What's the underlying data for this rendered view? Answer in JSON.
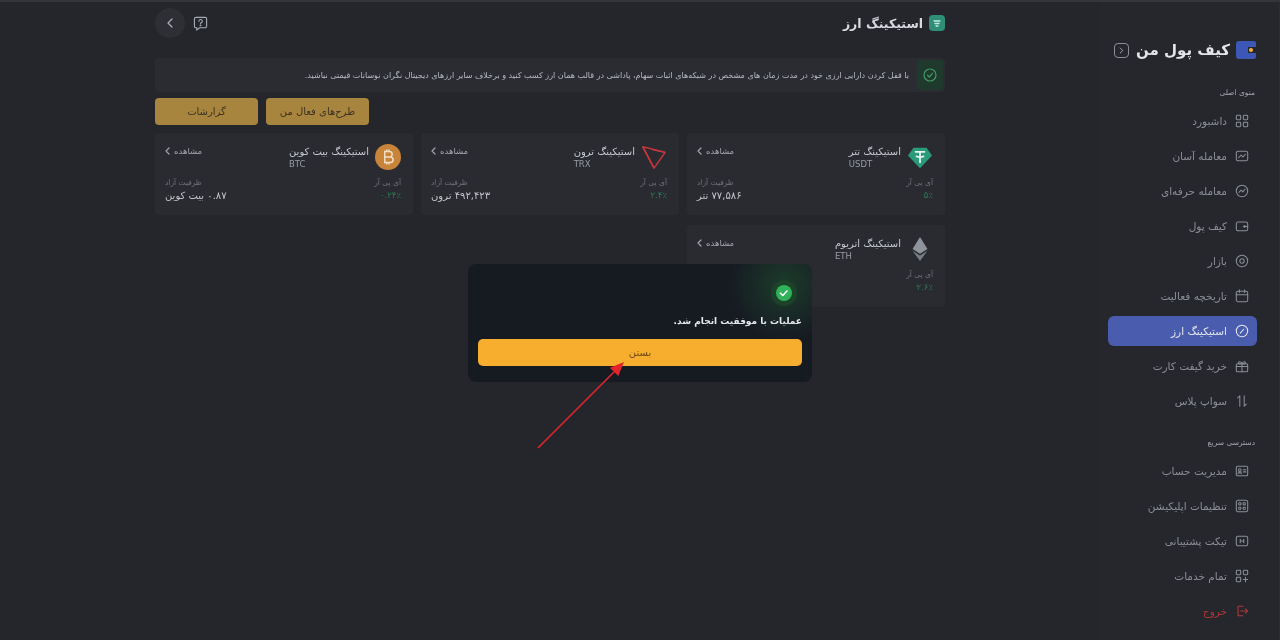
{
  "sidebar": {
    "logo": "کیف پول من",
    "sections": [
      {
        "title": "منوی اصلی",
        "items": [
          {
            "label": "داشبورد",
            "kind": "dashboard",
            "selected": false
          },
          {
            "label": "معامله آسان",
            "kind": "easy-trade",
            "selected": false
          },
          {
            "label": "معامله حرفه‌ای",
            "kind": "pro-trade",
            "selected": false
          },
          {
            "label": "کیف پول",
            "kind": "wallet",
            "selected": false
          },
          {
            "label": "بازار",
            "kind": "market",
            "selected": false
          },
          {
            "label": "تاریخچه فعالیت",
            "kind": "history",
            "selected": false
          },
          {
            "label": "استیکینگ ارز",
            "kind": "staking",
            "selected": true
          },
          {
            "label": "خرید گیفت کارت",
            "kind": "gift-card",
            "selected": false
          },
          {
            "label": "سواپ پلاس",
            "kind": "swap",
            "selected": false
          }
        ]
      },
      {
        "title": "دسترسی سریع",
        "items": [
          {
            "label": "مدیریت حساب",
            "kind": "account",
            "selected": false
          },
          {
            "label": "تنظیمات اپلیکیشن",
            "kind": "settings",
            "selected": false
          },
          {
            "label": "تیکت پشتیبانی",
            "kind": "ticket",
            "selected": false
          },
          {
            "label": "تمام خدمات",
            "kind": "services",
            "selected": false
          },
          {
            "label": "خروج",
            "kind": "logout",
            "selected": false
          }
        ]
      }
    ]
  },
  "header": {
    "title": "استیکینگ ارز"
  },
  "banner": {
    "text": "با قفل کردن دارایی ارزی خود در مدت زمان های مشخص در شبکه‌های اثبات سهام، پاداشی در قالب همان ارز کسب کنید و برخلاف سایر ارزهای دیجیتال نگران نوسانات قیمتی نباشید."
  },
  "actions": [
    {
      "label": "طرح‌های فعال من"
    },
    {
      "label": "گزارشات"
    }
  ],
  "cards": [
    {
      "kind": "usdt",
      "name": "استیکینگ تتر",
      "ticker": "USDT",
      "link": "مشاهده",
      "apr_label": "آی پی آر",
      "apr": "۵٪",
      "capacity_label": "ظرفیت آزاد",
      "capacity": "۷۷,۵۸۶ تتر"
    },
    {
      "kind": "trx",
      "name": "استیکینگ ترون",
      "ticker": "TRX",
      "link": "مشاهده",
      "apr_label": "آی پی آر",
      "apr": "۲.۴٪",
      "capacity_label": "ظرفیت آزاد",
      "capacity": "۴۹۲,۴۲۳ ترون"
    },
    {
      "kind": "btc",
      "name": "استیکینگ بیت کوین",
      "ticker": "BTC",
      "link": "مشاهده",
      "apr_label": "آی پی آر",
      "apr": "۰.۲۴٪",
      "capacity_label": "ظرفیت آزاد",
      "capacity": "۰.۸۷ بیت کوین"
    },
    {
      "kind": "eth",
      "name": "استیکینگ اتریوم",
      "ticker": "ETH",
      "link": "مشاهده",
      "apr_label": "آی پی آر",
      "apr": "۲.۶٪"
    }
  ],
  "dialog": {
    "message": "عملیات با موفقیت انجام شد.",
    "button": "بستن"
  }
}
